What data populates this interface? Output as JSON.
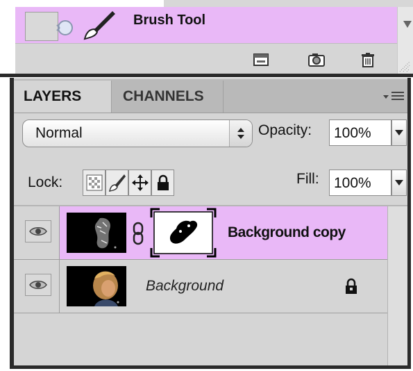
{
  "history": {
    "state_label": "Brush Tool"
  },
  "layers_panel": {
    "tabs": [
      {
        "label": "LAYERS",
        "active": true
      },
      {
        "label": "CHANNELS",
        "active": false
      }
    ],
    "blend_mode": "Normal",
    "opacity_label": "Opacity:",
    "opacity_value": "100%",
    "lock_label": "Lock:",
    "fill_label": "Fill:",
    "fill_value": "100%",
    "layers": [
      {
        "name": "Background copy",
        "selected": true,
        "visible": true,
        "has_mask": true,
        "locked": false
      },
      {
        "name": "Background",
        "selected": false,
        "visible": true,
        "has_mask": false,
        "locked": true
      }
    ]
  },
  "colors": {
    "selection": "#e9b8f7",
    "panel": "#d5d5d5",
    "frame": "#2a2a2a"
  }
}
